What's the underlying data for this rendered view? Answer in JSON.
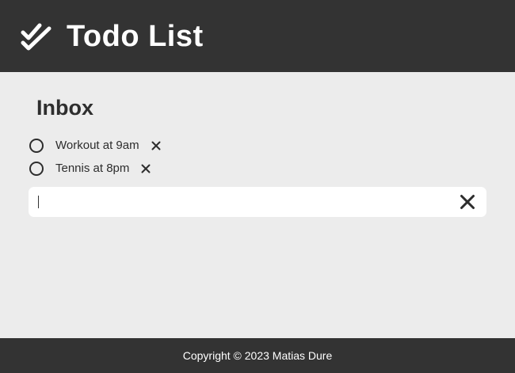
{
  "header": {
    "title": "Todo List",
    "logo_icon": "double-check-icon"
  },
  "main": {
    "section_title": "Inbox",
    "todos": [
      {
        "text": "Workout at 9am",
        "done": false
      },
      {
        "text": "Tennis at 8pm",
        "done": false
      }
    ],
    "new_todo": {
      "value": "",
      "placeholder": ""
    }
  },
  "footer": {
    "copyright": "Copyright © 2023 Matias Dure"
  },
  "colors": {
    "header_bg": "#333333",
    "page_bg": "#ececec",
    "text": "#2d2d2d",
    "input_bg": "#ffffff"
  }
}
